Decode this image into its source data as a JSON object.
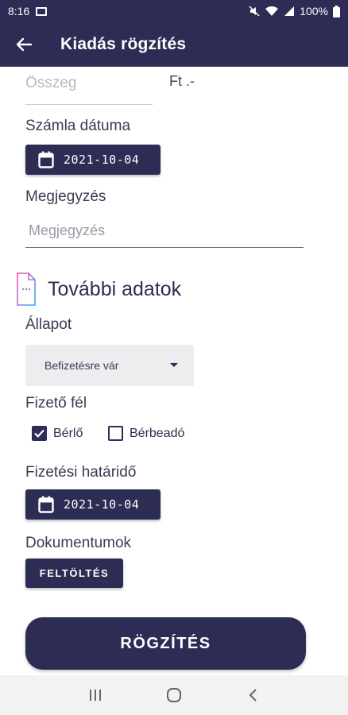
{
  "status_bar": {
    "time": "8:16",
    "battery": "100%"
  },
  "app_bar": {
    "title": "Kiadás rögzítés"
  },
  "form": {
    "amount": {
      "placeholder": "Összeg",
      "value": "",
      "currency": "Ft .-"
    },
    "invoice_date": {
      "label": "Számla dátuma",
      "value": "2021-10-04"
    },
    "note": {
      "label": "Megjegyzés",
      "placeholder": "Megjegyzés",
      "value": ""
    }
  },
  "additional": {
    "title": "További adatok",
    "status": {
      "label": "Állapot",
      "selected": "Befizetésre vár"
    },
    "payer": {
      "label": "Fizető fél",
      "options": [
        {
          "label": "Bérlő",
          "checked": true
        },
        {
          "label": "Bérbeadó",
          "checked": false
        }
      ]
    },
    "due_date": {
      "label": "Fizetési határidő",
      "value": "2021-10-04"
    },
    "documents": {
      "label": "Dokumentumok",
      "upload_label": "FELTÖLTÉS"
    }
  },
  "submit_label": "RÖGZÍTÉS",
  "colors": {
    "primary": "#2c2c55",
    "field_bg": "#ededf0",
    "text": "#3b3b52"
  },
  "icons": [
    "back-arrow-icon",
    "calendar-icon",
    "document-icon",
    "dropdown-caret-icon",
    "checkbox-icon",
    "recents-icon",
    "home-icon",
    "back-nav-icon"
  ]
}
